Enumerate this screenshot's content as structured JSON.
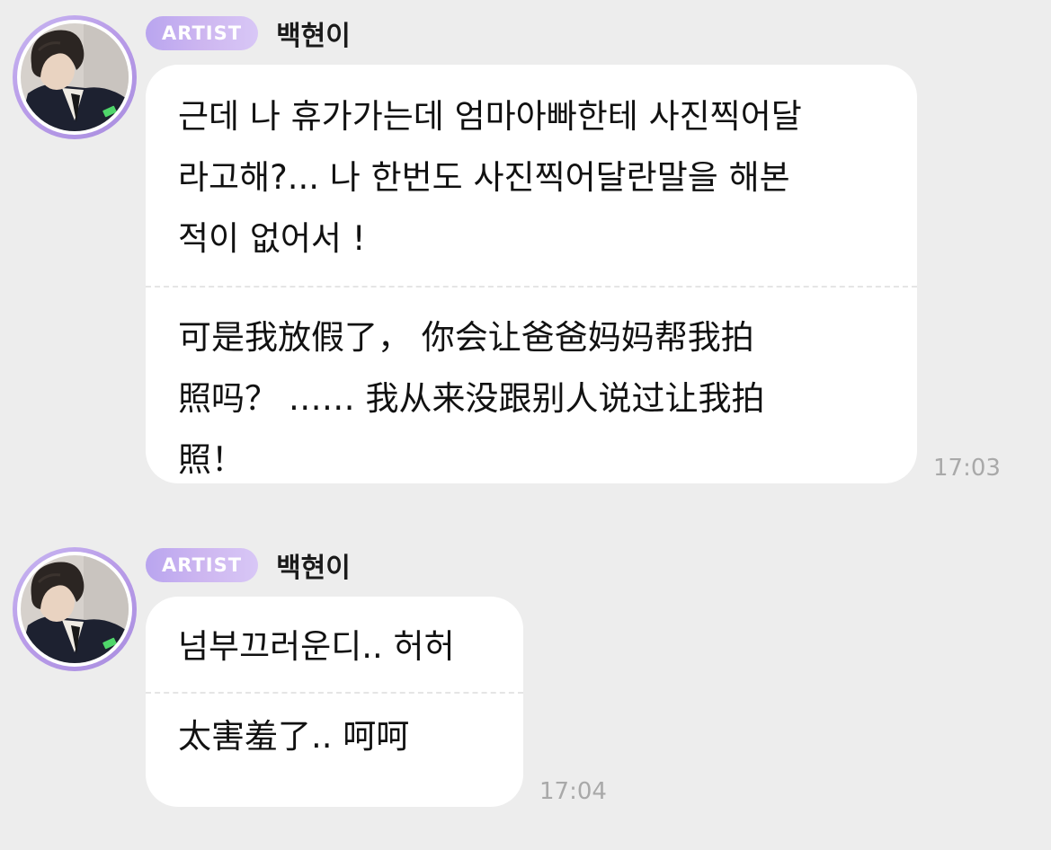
{
  "messages": [
    {
      "badge": "ARTIST",
      "sender": "백현이",
      "korean": "근데 나 휴가가는데 엄마아빠한테 사진찍어달\n라고해?... 나 한번도 사진찍어달란말을 해본\n적이 없어서 !",
      "chinese": "可是我放假了， 你会让爸爸妈妈帮我拍\n照吗？ …… 我从来没跟别人说过让我拍\n照！",
      "time": "17:03"
    },
    {
      "badge": "ARTIST",
      "sender": "백현이",
      "korean": "넘부끄러운디.. 허허",
      "chinese": "太害羞了.. 呵呵",
      "time": "17:04"
    }
  ],
  "colors": {
    "background": "#ededed",
    "bubble": "#ffffff",
    "badge_start": "#b9a5ef",
    "badge_end": "#d8c7f6",
    "avatar_ring": "#b99ce8",
    "time": "#a9a9a9"
  }
}
